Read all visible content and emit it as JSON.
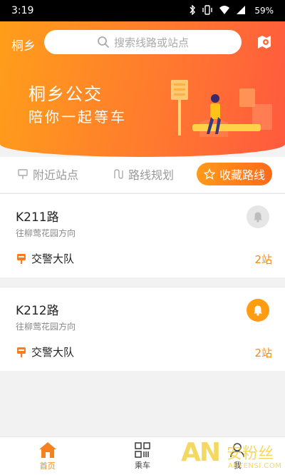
{
  "status_bar": {
    "time": "3:19",
    "battery": "59%"
  },
  "header": {
    "city": "桐乡",
    "search_placeholder": "搜索线路或站点",
    "banner_title": "桐乡公交",
    "banner_subtitle": "陪你一起等车"
  },
  "tabs": [
    {
      "label": "附近站点",
      "active": false
    },
    {
      "label": "路线规划",
      "active": false
    },
    {
      "label": "收藏路线",
      "active": true
    }
  ],
  "routes": [
    {
      "name": "K211路",
      "direction": "往柳莺花园方向",
      "stop": "交警大队",
      "stops_away": "2站",
      "alert_on": false
    },
    {
      "name": "K212路",
      "direction": "往柳莺花园方向",
      "stop": "交警大队",
      "stops_away": "2站",
      "alert_on": true
    }
  ],
  "bottom_nav": [
    {
      "label": "首页",
      "icon": "home-icon",
      "active": true
    },
    {
      "label": "乘车",
      "icon": "qr-code-icon",
      "active": false
    },
    {
      "label": "我",
      "icon": "person-icon",
      "active": false
    }
  ],
  "watermark": {
    "mark": "AN",
    "cn": "安粉丝",
    "en": "ANFENSI.COM"
  },
  "colors": {
    "accent": "#ff8a1a",
    "hero_start": "#ff9e1a",
    "hero_end": "#ff5a3e"
  }
}
